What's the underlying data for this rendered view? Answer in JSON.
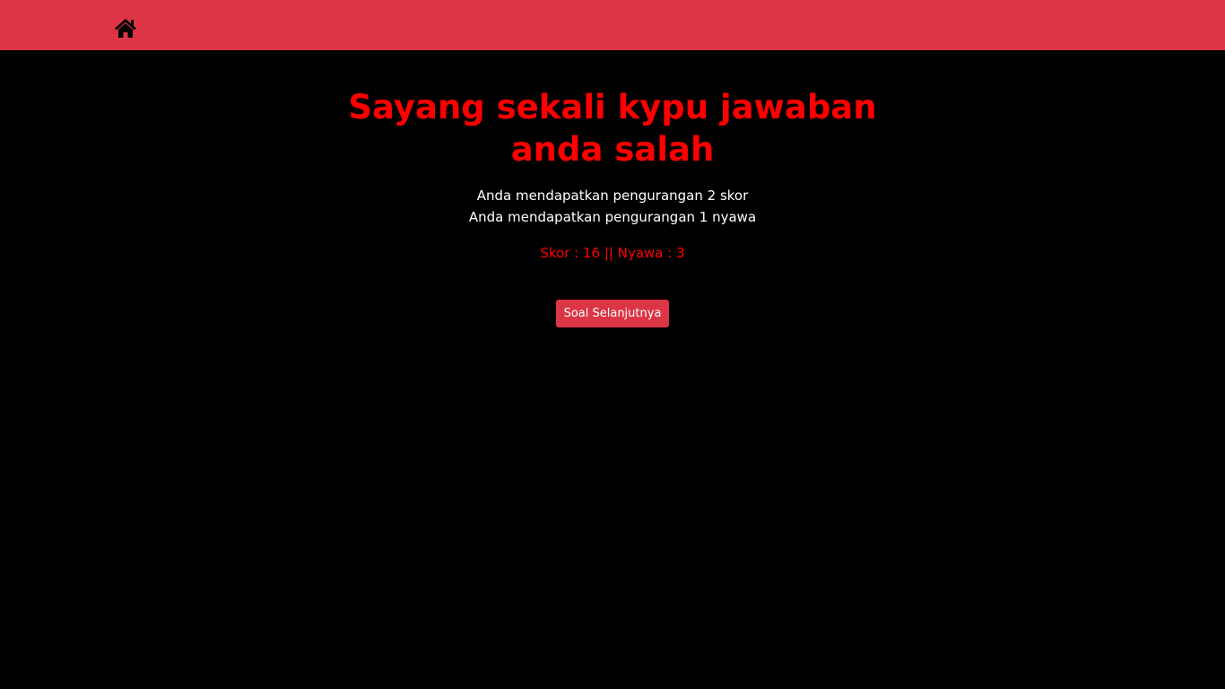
{
  "navbar": {
    "bg_color": "#dc3545",
    "home_icon": "home-icon"
  },
  "result": {
    "title": "Sayang sekali kypu jawaban anda salah",
    "title_color": "#ff0000",
    "messages": [
      "Anda mendapatkan pengurangan 2 skor",
      "Anda mendapatkan pengurangan 1 nyawa"
    ],
    "score_label": "Skor",
    "score_value": "16",
    "lives_label": "Nyawa",
    "lives_value": "3",
    "separator": "||"
  },
  "next_button": {
    "label": "Soal Selanjutnya",
    "color": "#dc3545"
  }
}
